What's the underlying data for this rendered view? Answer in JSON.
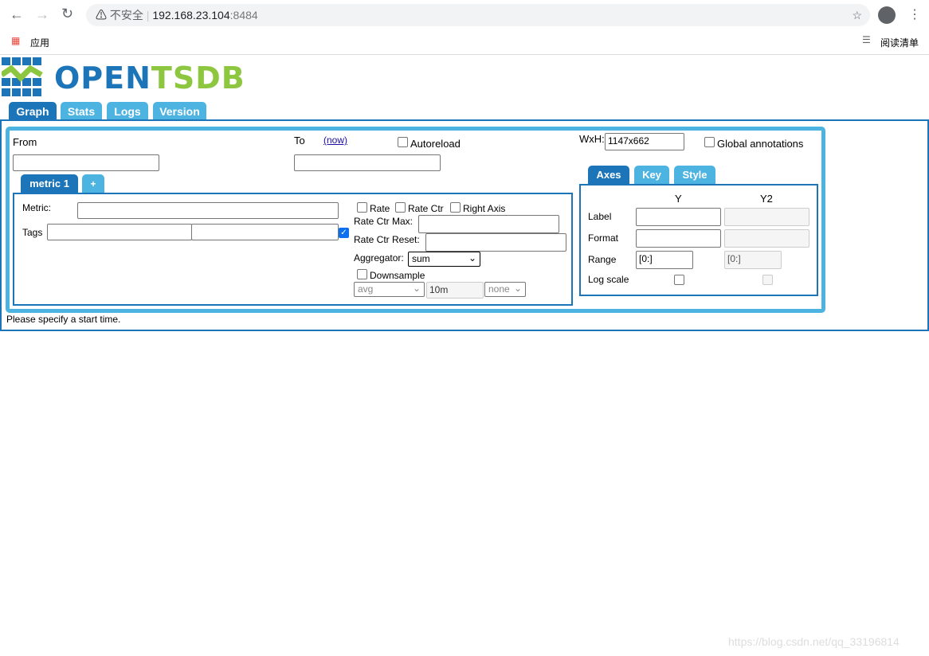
{
  "browser": {
    "security": "不安全",
    "url_host": "192.168.23.104",
    "url_port": ":8484",
    "bookmarks_apps": "应用",
    "reading_list": "阅读清单"
  },
  "logo": {
    "open": "OPEN",
    "tsdb": "TSDB"
  },
  "tabs": [
    {
      "label": "Graph",
      "active": true
    },
    {
      "label": "Stats"
    },
    {
      "label": "Logs"
    },
    {
      "label": "Version"
    }
  ],
  "query": {
    "from_label": "From",
    "from_value": "",
    "to_label": "To",
    "now_link": "(now)",
    "to_value": "",
    "autoreload_label": "Autoreload",
    "wxh_label": "WxH:",
    "wxh_value": "1147x662",
    "global_annotations_label": "Global annotations"
  },
  "metric_tabs": [
    {
      "label": "metric 1",
      "active": true
    },
    {
      "label": "+"
    }
  ],
  "metric": {
    "metric_label": "Metric:",
    "tags_label": "Tags",
    "rate_label": "Rate",
    "rate_ctr_label": "Rate Ctr",
    "right_axis_label": "Right Axis",
    "rate_ctr_max_label": "Rate Ctr Max:",
    "rate_ctr_reset_label": "Rate Ctr Reset:",
    "aggregator_label": "Aggregator:",
    "aggregator_value": "sum",
    "downsample_label": "Downsample",
    "downsample_func": "avg",
    "downsample_interval": "10m",
    "downsample_fill": "none",
    "tags_checkbox_checked": true
  },
  "axes_tabs": [
    {
      "label": "Axes",
      "active": true
    },
    {
      "label": "Key"
    },
    {
      "label": "Style"
    }
  ],
  "axes": {
    "y_header": "Y",
    "y2_header": "Y2",
    "label_row": "Label",
    "format_row": "Format",
    "range_row": "Range",
    "log_row": "Log scale",
    "y_range": "[0:]",
    "y2_range": "[0:]"
  },
  "status": "Please specify a start time.",
  "watermark": "https://blog.csdn.net/qq_33196814",
  "colors": {
    "dark_blue": "#1b75b8",
    "light_blue": "#4db3e0",
    "green": "#8dc63f"
  }
}
